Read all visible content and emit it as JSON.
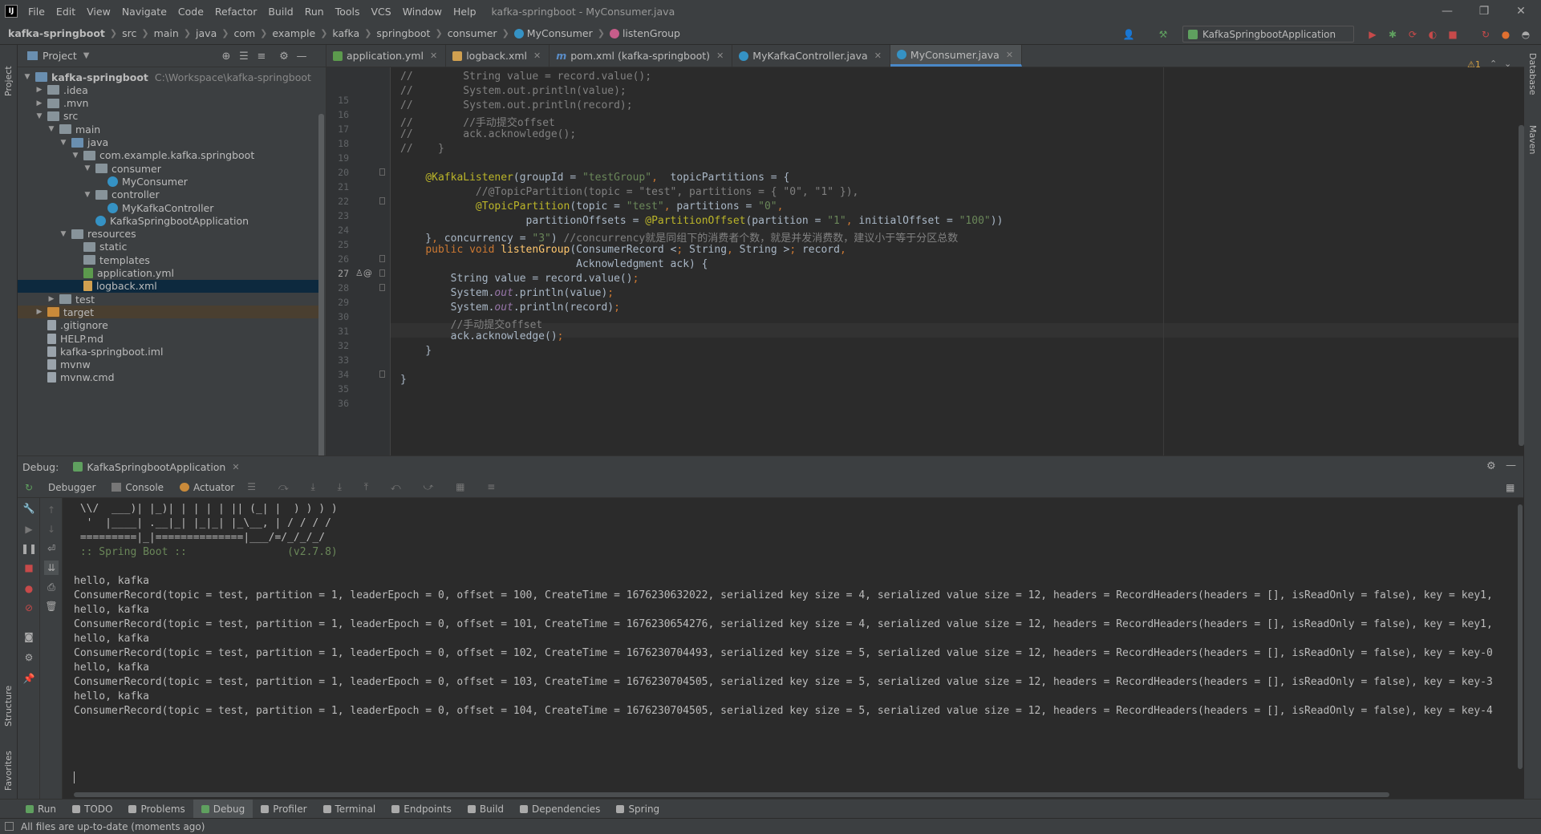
{
  "menubar": {
    "logo": "IJ",
    "items": [
      "File",
      "Edit",
      "View",
      "Navigate",
      "Code",
      "Refactor",
      "Build",
      "Run",
      "Tools",
      "VCS",
      "Window",
      "Help"
    ],
    "title": "kafka-springboot - MyConsumer.java",
    "controls": [
      "—",
      "❐",
      "✕"
    ]
  },
  "navbar": {
    "crumbs": [
      "kafka-springboot",
      "src",
      "main",
      "java",
      "com",
      "example",
      "kafka",
      "springboot",
      "consumer",
      "MyConsumer",
      "listenGroup"
    ],
    "run_config": "KafkaSpringbootApplication"
  },
  "project": {
    "header": "Project",
    "tree": [
      {
        "label": "kafka-springboot",
        "muted": "C:\\Workspace\\kafka-springboot",
        "bold": true,
        "arrow": "▼",
        "icon": "folder-module"
      },
      {
        "label": ".idea",
        "arrow": "▶",
        "icon": "folder"
      },
      {
        "label": ".mvn",
        "arrow": "▶",
        "icon": "folder"
      },
      {
        "label": "src",
        "arrow": "▼",
        "icon": "folder"
      },
      {
        "label": "main",
        "arrow": "▼",
        "icon": "folder"
      },
      {
        "label": "java",
        "arrow": "▼",
        "icon": "folder-source"
      },
      {
        "label": "com.example.kafka.springboot",
        "arrow": "▼",
        "icon": "package"
      },
      {
        "label": "consumer",
        "arrow": "▼",
        "icon": "package"
      },
      {
        "label": "MyConsumer",
        "arrow": "",
        "icon": "class"
      },
      {
        "label": "controller",
        "arrow": "▼",
        "icon": "package"
      },
      {
        "label": "MyKafkaController",
        "arrow": "",
        "icon": "class"
      },
      {
        "label": "KafkaSpringbootApplication",
        "arrow": "",
        "icon": "spring-class"
      },
      {
        "label": "resources",
        "arrow": "▼",
        "icon": "folder-resources"
      },
      {
        "label": "static",
        "arrow": "",
        "icon": "folder"
      },
      {
        "label": "templates",
        "arrow": "",
        "icon": "folder"
      },
      {
        "label": "application.yml",
        "arrow": "",
        "icon": "yml-file"
      },
      {
        "label": "logback.xml",
        "arrow": "",
        "icon": "xml-file",
        "selected": true
      },
      {
        "label": "test",
        "arrow": "▶",
        "icon": "folder"
      },
      {
        "label": "target",
        "arrow": "▶",
        "icon": "folder-excluded",
        "highlight": true
      },
      {
        "label": ".gitignore",
        "arrow": "",
        "icon": "file"
      },
      {
        "label": "HELP.md",
        "arrow": "",
        "icon": "file"
      },
      {
        "label": "kafka-springboot.iml",
        "arrow": "",
        "icon": "file"
      },
      {
        "label": "mvnw",
        "arrow": "",
        "icon": "file"
      },
      {
        "label": "mvnw.cmd",
        "arrow": "",
        "icon": "file"
      }
    ]
  },
  "editor": {
    "tabs": [
      {
        "label": "application.yml",
        "active": false
      },
      {
        "label": "logback.xml",
        "active": false
      },
      {
        "label": "pom.xml (kafka-springboot)",
        "active": false
      },
      {
        "label": "MyKafkaController.java",
        "active": false
      },
      {
        "label": "MyConsumer.java",
        "active": true
      }
    ],
    "inspection": "⚠1",
    "line_numbers": [
      "15",
      "16",
      "17",
      "18",
      "19",
      "20",
      "21",
      "22",
      "23",
      "24",
      "25",
      "26",
      "27",
      "28",
      "29",
      "30",
      "31",
      "32",
      "33",
      "34",
      "35",
      "36"
    ],
    "code": [
      "//        String value = record.value();",
      "//        System.out.println(value);",
      "//        System.out.println(record);",
      "//        //手动提交offset",
      "//        ack.acknowledge();",
      "//    }",
      "",
      "    @KafkaListener(groupId = \"testGroup\",  topicPartitions = {",
      "            //@TopicPartition(topic = \"test\", partitions = { \"0\", \"1\" }),",
      "            @TopicPartition(topic = \"test\", partitions = \"0\",",
      "                    partitionOffsets = @PartitionOffset(partition = \"1\", initialOffset = \"100\"))",
      "    }, concurrency = \"3\") //concurrency就是同组下的消费者个数，就是并发消费数，建议小于等于分区总数",
      "    public void listenGroup(ConsumerRecord < String, String > record,",
      "                            Acknowledgment ack) {",
      "        String value = record.value();",
      "        System.out.println(value);",
      "        System.out.println(record);",
      "        //手动提交offset",
      "        ack.acknowledge();",
      "    }",
      "",
      "}"
    ]
  },
  "debug": {
    "label": "Debug:",
    "session": "KafkaSpringbootApplication",
    "tabs": [
      "Debugger",
      "Console",
      "Actuator"
    ],
    "console_lines": [
      " \\\\/  ___)| |_)| | | | | || (_| |  ) ) ) )",
      "  '  |____| .__|_| |_|_| |_\\__, | / / / /",
      " =========|_|==============|___/=/_/_/_/",
      " :: Spring Boot ::                (v2.7.8)",
      "",
      "hello, kafka",
      "ConsumerRecord(topic = test, partition = 1, leaderEpoch = 0, offset = 100, CreateTime = 1676230632022, serialized key size = 4, serialized value size = 12, headers = RecordHeaders(headers = [], isReadOnly = false), key = key1,",
      "hello, kafka",
      "ConsumerRecord(topic = test, partition = 1, leaderEpoch = 0, offset = 101, CreateTime = 1676230654276, serialized key size = 4, serialized value size = 12, headers = RecordHeaders(headers = [], isReadOnly = false), key = key1,",
      "hello, kafka",
      "ConsumerRecord(topic = test, partition = 1, leaderEpoch = 0, offset = 102, CreateTime = 1676230704493, serialized key size = 5, serialized value size = 12, headers = RecordHeaders(headers = [], isReadOnly = false), key = key-0",
      "hello, kafka",
      "ConsumerRecord(topic = test, partition = 1, leaderEpoch = 0, offset = 103, CreateTime = 1676230704505, serialized key size = 5, serialized value size = 12, headers = RecordHeaders(headers = [], isReadOnly = false), key = key-3",
      "hello, kafka",
      "ConsumerRecord(topic = test, partition = 1, leaderEpoch = 0, offset = 104, CreateTime = 1676230704505, serialized key size = 5, serialized value size = 12, headers = RecordHeaders(headers = [], isReadOnly = false), key = key-4"
    ]
  },
  "bottom_tabs": [
    {
      "label": "Run",
      "icon": "run-icon"
    },
    {
      "label": "TODO",
      "icon": "todo-icon"
    },
    {
      "label": "Problems",
      "icon": "problems-icon"
    },
    {
      "label": "Debug",
      "icon": "debug-icon",
      "active": true
    },
    {
      "label": "Profiler",
      "icon": "profiler-icon"
    },
    {
      "label": "Terminal",
      "icon": "terminal-icon"
    },
    {
      "label": "Endpoints",
      "icon": "endpoints-icon"
    },
    {
      "label": "Build",
      "icon": "build-icon"
    },
    {
      "label": "Dependencies",
      "icon": "dependencies-icon"
    },
    {
      "label": "Spring",
      "icon": "spring-icon"
    }
  ],
  "side_tabs": {
    "left": [
      "Project",
      "Structure",
      "Favorites"
    ],
    "right": [
      "Database",
      "Maven"
    ]
  },
  "status": "All files are up-to-date (moments ago)",
  "colors": {
    "accent": "#4a88c7",
    "bg": "#2b2b2b",
    "panel": "#3c3f41",
    "selection": "#0d293e",
    "keyword": "#cc7832",
    "string": "#6a8759",
    "annotation": "#bbb529"
  }
}
